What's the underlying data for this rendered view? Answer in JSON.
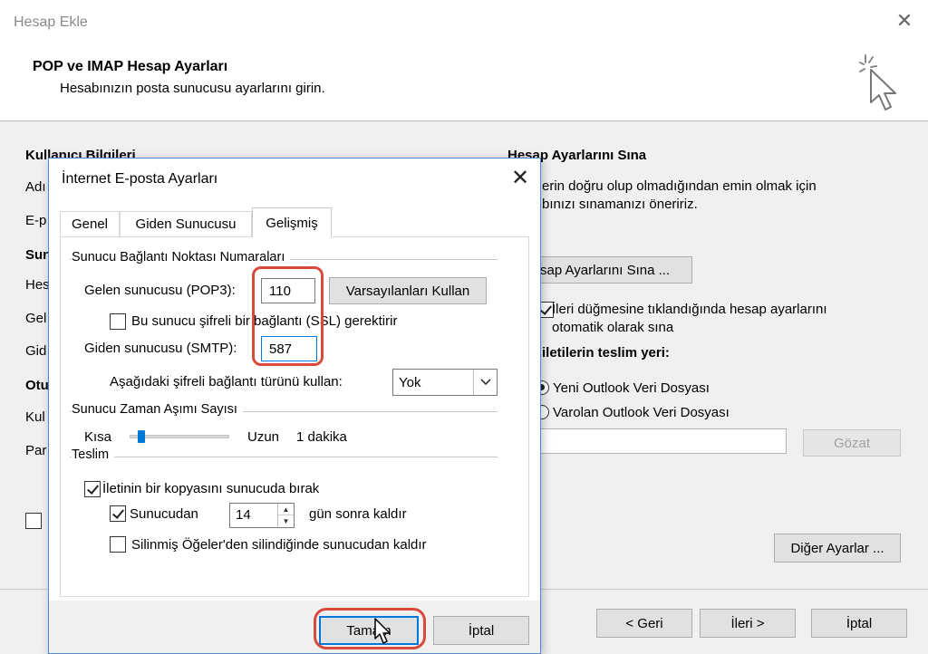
{
  "outer": {
    "title": "Hesap Ekle",
    "header_title": "POP ve IMAP Hesap Ayarları",
    "header_subtitle": "Hesabınızın posta sunucusu ayarlarını girin.",
    "left_labels": [
      "Kullanıcı Bilgileri",
      "Adı",
      "E-p",
      "Sun",
      "Hes",
      "Gel",
      "Gid",
      "Otu",
      "Kul",
      "Par"
    ],
    "test_section_title": "Hesap Ayarlarını Sına",
    "test_desc_line1": "erin doğru olup olmadığından emin olmak için",
    "test_desc_line2": "bınızı sınamanızı öneririz.",
    "test_button": "sap Ayarlarını Sına ...",
    "auto_test_line1": "İleri düğmesine tıklandığında hesap ayarlarını",
    "auto_test_line2": "otomatik olarak sına",
    "auto_test_checked": true,
    "delivery_title": "iletilerin teslim yeri:",
    "radio_new": "Yeni Outlook Veri Dosyası",
    "radio_existing": "Varolan Outlook Veri Dosyası",
    "radio_selected": "new",
    "browse_button": "Gözat",
    "more_settings_button": "Diğer Ayarlar ...",
    "back_button": "< Geri",
    "next_button": "İleri >",
    "cancel_button": "İptal"
  },
  "dialog": {
    "title": "İnternet E-posta Ayarları",
    "tabs": [
      "Genel",
      "Giden Sunucusu",
      "Gelişmiş"
    ],
    "active_tab": "Gelişmiş",
    "ports_group": "Sunucu Bağlantı Noktası Numaraları",
    "incoming_label": "Gelen sunucusu (POP3):",
    "incoming_value": "110",
    "defaults_button": "Varsayılanları Kullan",
    "ssl_label": "Bu sunucu şifreli bir bağlantı (SSL) gerektirir",
    "ssl_checked": false,
    "outgoing_label": "Giden sunucusu (SMTP):",
    "outgoing_value": "587",
    "encryption_label": "Aşağıdaki şifreli bağlantı türünü kullan:",
    "encryption_value": "Yok",
    "timeout_group": "Sunucu Zaman Aşımı Sayısı",
    "timeout_short": "Kısa",
    "timeout_long": "Uzun",
    "timeout_value": "1 dakika",
    "timeout_level": 0.08,
    "delivery_group": "Teslim",
    "leave_copy_label": "İletinin bir kopyasını sunucuda bırak",
    "leave_copy_checked": true,
    "remove_after_label": "Sunucudan",
    "remove_after_checked": true,
    "remove_after_days": "14",
    "remove_after_suffix": "gün sonra kaldır",
    "remove_deleted_label": "Silinmiş Öğeler'den silindiğinde sunucudan kaldır",
    "remove_deleted_checked": false,
    "ok_button": "Tamam",
    "cancel_button": "İptal"
  },
  "colors": {
    "highlight": "#d94a3d",
    "dialog_border": "#4a8bd6",
    "slider_thumb": "#0078d7"
  }
}
